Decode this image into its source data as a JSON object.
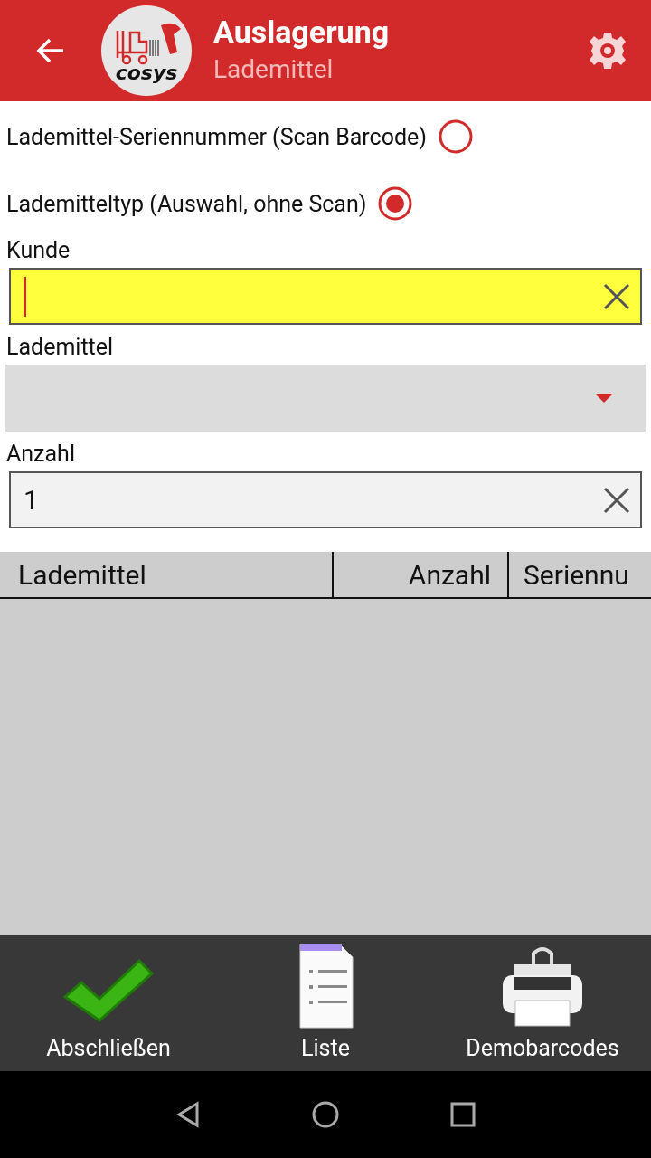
{
  "app_bar": {
    "title": "Auslagerung",
    "subtitle": "Lademittel",
    "logo_text": "cosys"
  },
  "mode_options": [
    {
      "label": "Lademittel-Seriennummer (Scan Barcode)",
      "selected": false
    },
    {
      "label": "Lademitteltyp (Auswahl, ohne Scan)",
      "selected": true
    }
  ],
  "fields": [
    {
      "kind": "text",
      "label": "Kunde",
      "focused": true
    },
    {
      "kind": "dropdown",
      "label": "Lademittel"
    },
    {
      "kind": "text",
      "label": "Anzahl",
      "value": "1",
      "focused": false
    }
  ],
  "table": {
    "columns": [
      {
        "label": "Lademittel"
      },
      {
        "label": "Anzahl"
      },
      {
        "label": "Seriennu"
      }
    ]
  },
  "bottom_actions": [
    {
      "kind": "check",
      "label": "Abschließen"
    },
    {
      "kind": "list",
      "label": "Liste"
    },
    {
      "kind": "printer",
      "label": "Demobarcodes"
    }
  ]
}
